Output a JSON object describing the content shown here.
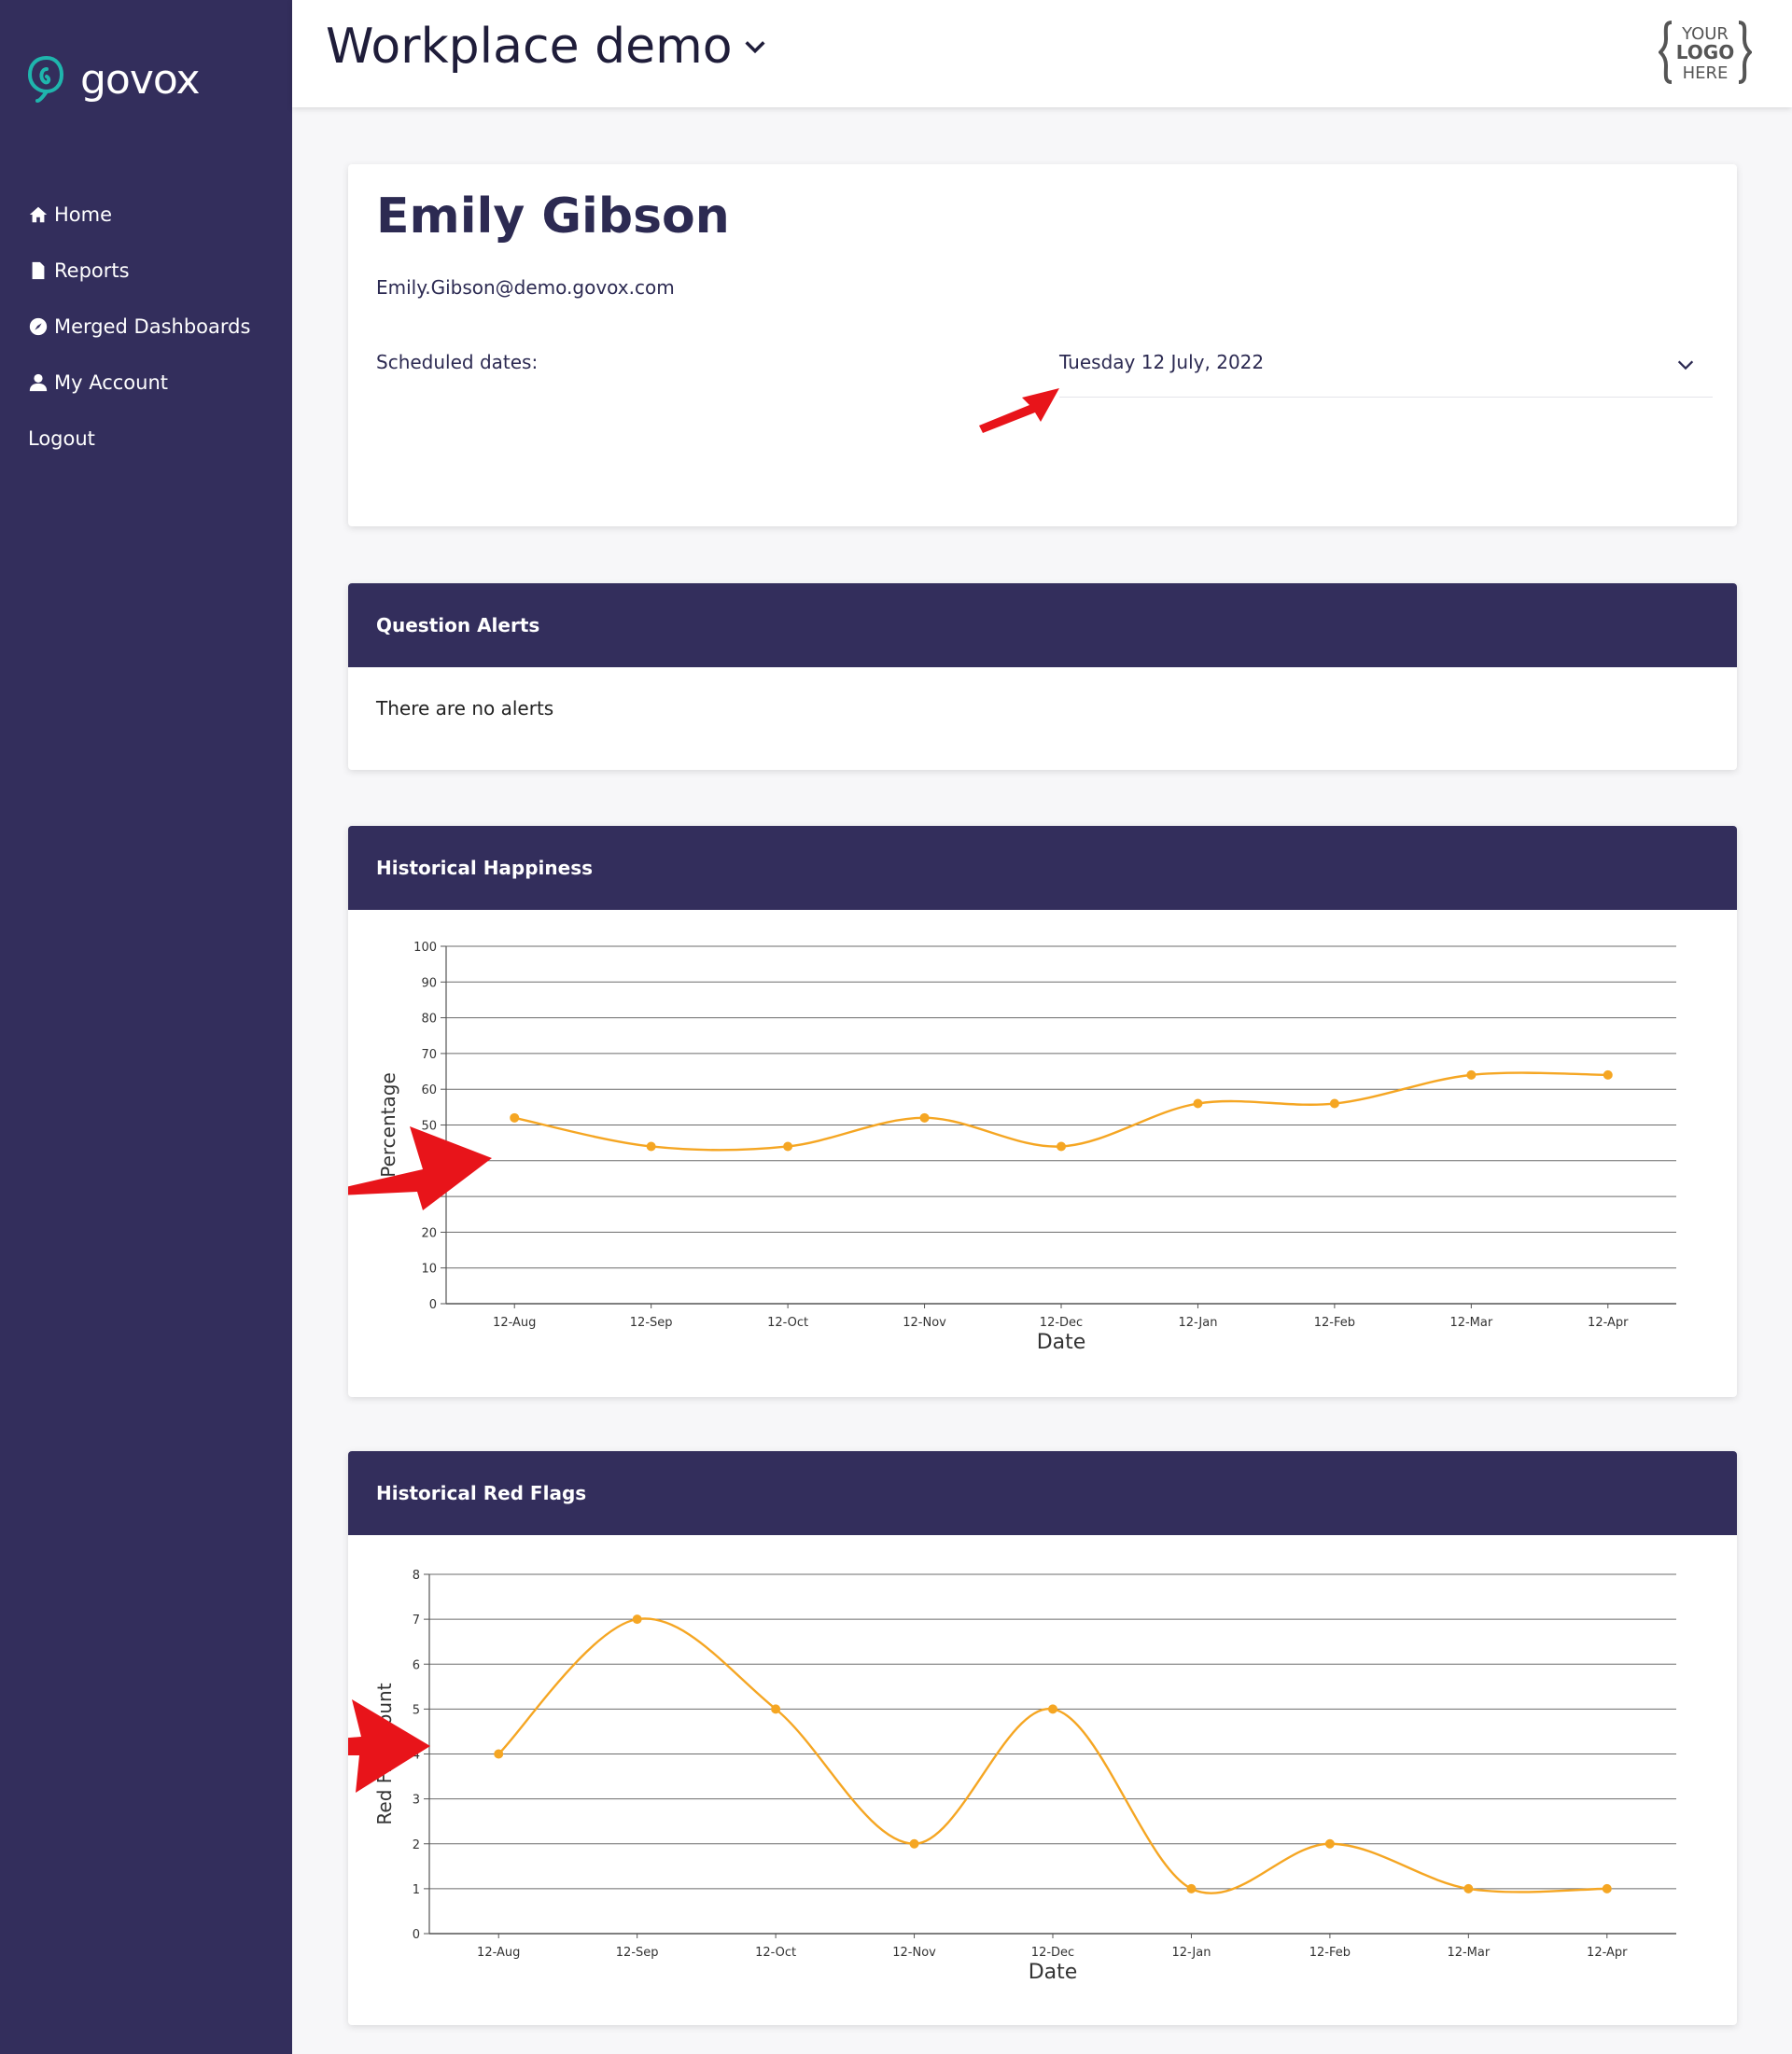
{
  "brand": {
    "name": "govox"
  },
  "nav": {
    "items": [
      {
        "label": "Home",
        "icon": "home-icon"
      },
      {
        "label": "Reports",
        "icon": "document-icon"
      },
      {
        "label": "Merged Dashboards",
        "icon": "compass-icon"
      },
      {
        "label": "My Account",
        "icon": "user-icon"
      },
      {
        "label": "Logout",
        "icon": ""
      }
    ]
  },
  "header": {
    "workspace": "Workplace demo",
    "logo": {
      "line1": "YOUR",
      "line2": "LOGO",
      "line3": "HERE"
    }
  },
  "profile": {
    "name": "Emily Gibson",
    "email": "Emily.Gibson@demo.govox.com",
    "scheduled_label": "Scheduled dates:",
    "scheduled_value": "Tuesday 12 July, 2022"
  },
  "alerts": {
    "title": "Question Alerts",
    "empty_text": "There are no alerts"
  },
  "happiness": {
    "title": "Historical Happiness"
  },
  "red_flags": {
    "title": "Historical Red Flags"
  },
  "colors": {
    "sidebar": "#332e5c",
    "line": "#f5a623",
    "accent_teal": "#1fb5ad"
  },
  "chart_data": [
    {
      "type": "line",
      "title": "Historical Happiness",
      "xlabel": "Date",
      "ylabel": "Percentage",
      "categories": [
        "12-Aug",
        "12-Sep",
        "12-Oct",
        "12-Nov",
        "12-Dec",
        "12-Jan",
        "12-Feb",
        "12-Mar",
        "12-Apr"
      ],
      "values": [
        52,
        44,
        44,
        52,
        44,
        56,
        56,
        64,
        64
      ],
      "ylim": [
        0,
        100
      ],
      "yticks": [
        0,
        10,
        20,
        30,
        40,
        50,
        60,
        70,
        80,
        90,
        100
      ],
      "grid": true
    },
    {
      "type": "line",
      "title": "Historical Red Flags",
      "xlabel": "Date",
      "ylabel": "Red Flag Count",
      "categories": [
        "12-Aug",
        "12-Sep",
        "12-Oct",
        "12-Nov",
        "12-Dec",
        "12-Jan",
        "12-Feb",
        "12-Mar",
        "12-Apr"
      ],
      "values": [
        4,
        7,
        5,
        2,
        5,
        1,
        2,
        1,
        1
      ],
      "ylim": [
        0,
        8
      ],
      "yticks": [
        0,
        1,
        2,
        3,
        4,
        5,
        6,
        7,
        8
      ],
      "grid": true
    }
  ]
}
